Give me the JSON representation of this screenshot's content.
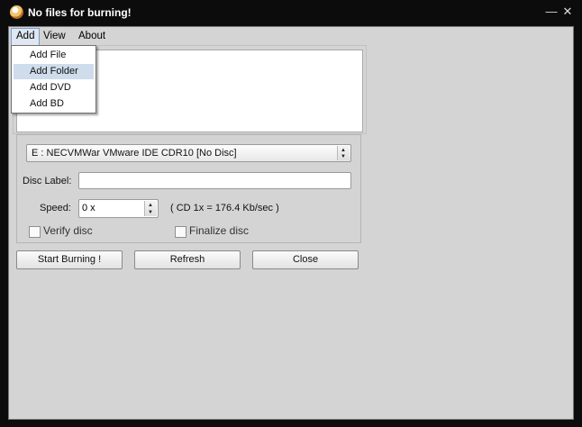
{
  "window": {
    "title": "No files for burning!",
    "controls": {
      "minimize": "—",
      "close": "✕"
    }
  },
  "menu": {
    "items": [
      "Add",
      "View",
      "About"
    ],
    "add_dropdown": [
      "Add File",
      "Add Folder",
      "Add DVD",
      "Add BD"
    ],
    "highlighted": "Add Folder"
  },
  "drive": {
    "selected": "E : NECVMWar VMware IDE CDR10    [No Disc]"
  },
  "disc_label": {
    "label": "Disc Label:",
    "value": ""
  },
  "speed": {
    "label": "Speed:",
    "value": "0 x",
    "note": "( CD 1x = 176.4 Kb/sec )"
  },
  "options": {
    "verify": "Verify disc",
    "finalize": "Finalize disc"
  },
  "buttons": {
    "start": "Start Burning !",
    "refresh": "Refresh",
    "close": "Close"
  }
}
